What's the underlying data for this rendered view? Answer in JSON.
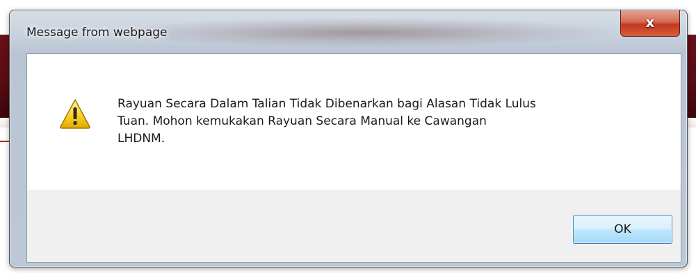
{
  "dialog": {
    "title": "Message from webpage",
    "close_label": "x",
    "icon": "warning-icon",
    "message": "Rayuan Secara Dalam Talian Tidak Dibenarkan bagi Alasan Tidak Lulus\nTuan. Mohon kemukakan Rayuan Secara Manual ke Cawangan\nLHDNM.",
    "ok_label": "OK"
  },
  "colors": {
    "background_band": "#5a0c14",
    "close_button": "#c2381d",
    "ok_button_border": "#3c7fb1"
  }
}
